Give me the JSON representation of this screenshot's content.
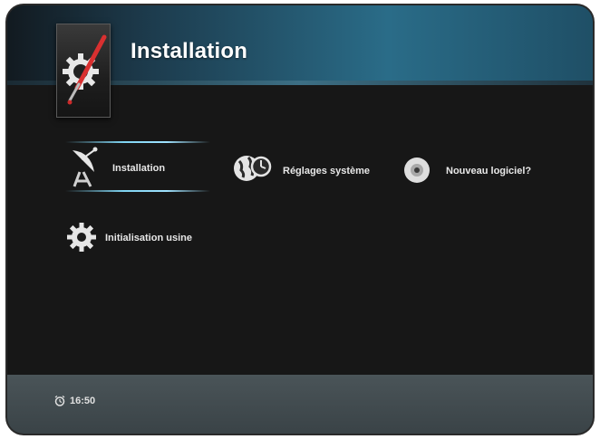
{
  "header": {
    "title": "Installation",
    "icon": "settings-paint-icon"
  },
  "menu": {
    "items": [
      {
        "label": "Installation",
        "icon": "satellite-dish-icon",
        "selected": true
      },
      {
        "label": "Réglages système",
        "icon": "globe-clock-icon",
        "selected": false
      },
      {
        "label": "Nouveau logiciel?",
        "icon": "disc-icon",
        "selected": false
      },
      {
        "label": "Initialisation usine",
        "icon": "gear-icon",
        "selected": false
      }
    ]
  },
  "footer": {
    "clock_icon": "alarm-clock-icon",
    "time": "16:50"
  },
  "colors": {
    "header_accent": "#2a6c88",
    "selection": "#7fd4f2",
    "background": "#171717",
    "footer": "#4a5458"
  }
}
